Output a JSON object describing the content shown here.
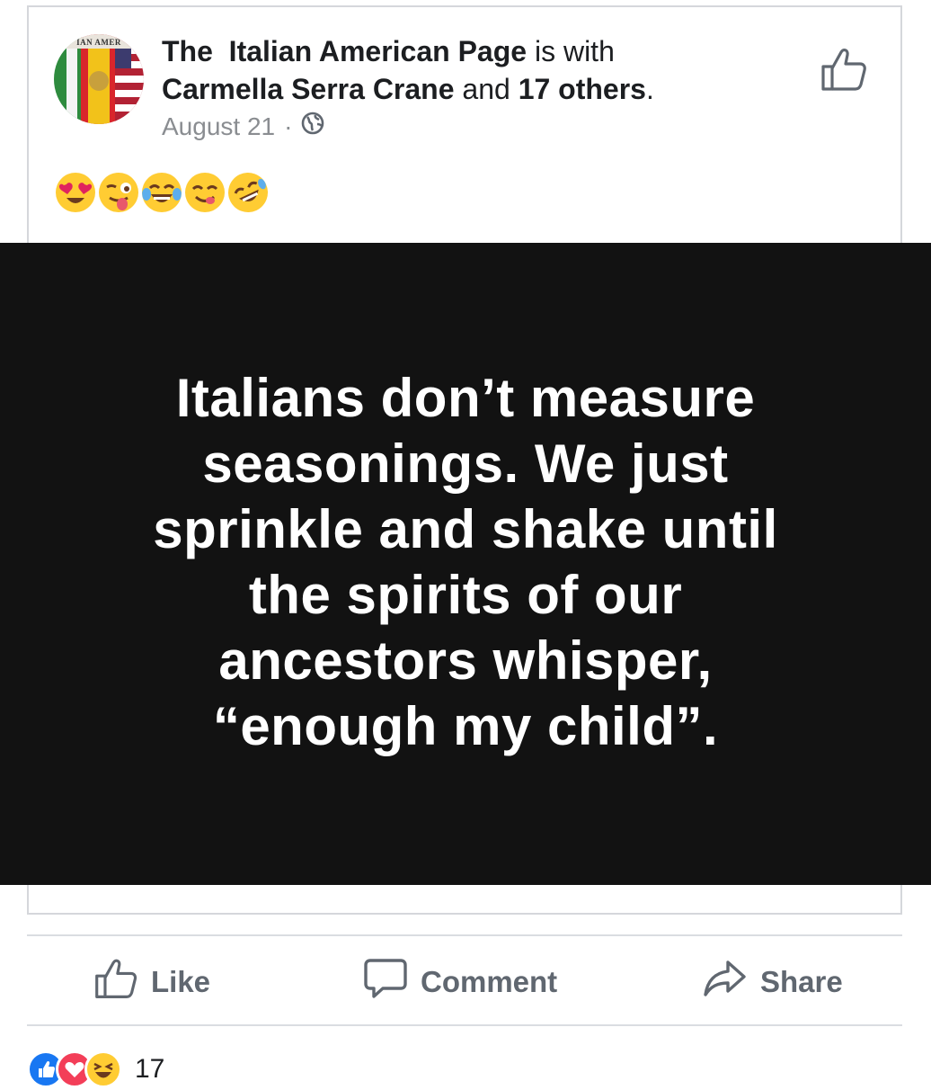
{
  "post": {
    "page_name": "The  Italian American Page",
    "with_text": "is with",
    "tagged_name": "Carmella Serra Crane",
    "and_text": "and",
    "others_text": "17 others",
    "period": ".",
    "date": "August 21",
    "date_separator": "·",
    "privacy_icon": "globe-icon",
    "avatar_banner": "IAN AMER",
    "emojis": [
      "heart-eyes-face",
      "winking-tongue-face",
      "tears-of-joy-face",
      "yum-face",
      "rolling-laughing-face"
    ],
    "image_text": [
      "Italians don’t measure",
      "seasonings. We just",
      "sprinkle and shake until",
      "the spirits of our",
      "ancestors whisper,",
      "“enough my child”."
    ]
  },
  "actions": {
    "like": "Like",
    "comment": "Comment",
    "share": "Share"
  },
  "reactions": {
    "icons": [
      "like-reaction",
      "love-reaction",
      "haha-reaction"
    ],
    "count": "17"
  },
  "colors": {
    "meme_background": "#121212",
    "action_text": "#606770",
    "timestamp": "#8a8d91",
    "like_blue": "#1877f2",
    "love_red": "#f33e58"
  }
}
